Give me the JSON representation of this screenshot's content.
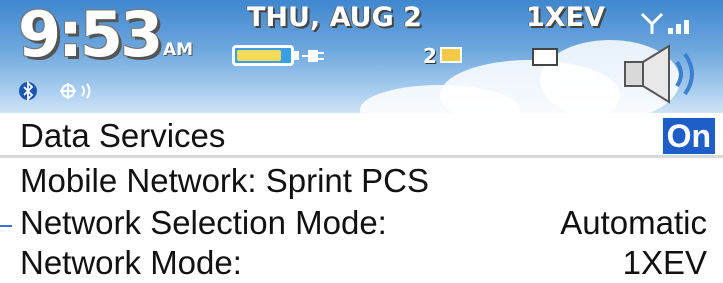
{
  "status": {
    "time": "9:53",
    "ampm": "AM",
    "date": "THU, AUG 2",
    "network_type": "1XEV",
    "unread_messages": "2",
    "battery_level": 0.85,
    "colors": {
      "sky": "#6fa8de",
      "toggle": "#1f5ec7",
      "battery_fill": "#f6da5a"
    },
    "icons": [
      "bluetooth-icon",
      "vibrate-icon",
      "signal-icon",
      "battery-icon",
      "charging-plug-icon",
      "envelope-icon",
      "calendar-icon",
      "speaker-icon"
    ]
  },
  "settings": {
    "data_services": {
      "label": "Data Services",
      "value": "On"
    },
    "mobile_network": {
      "label": "Mobile Network: Sprint PCS"
    },
    "network_selection": {
      "label": "Network Selection Mode:",
      "value": "Automatic"
    },
    "network_mode": {
      "label": "Network Mode:",
      "value": "1XEV"
    }
  }
}
